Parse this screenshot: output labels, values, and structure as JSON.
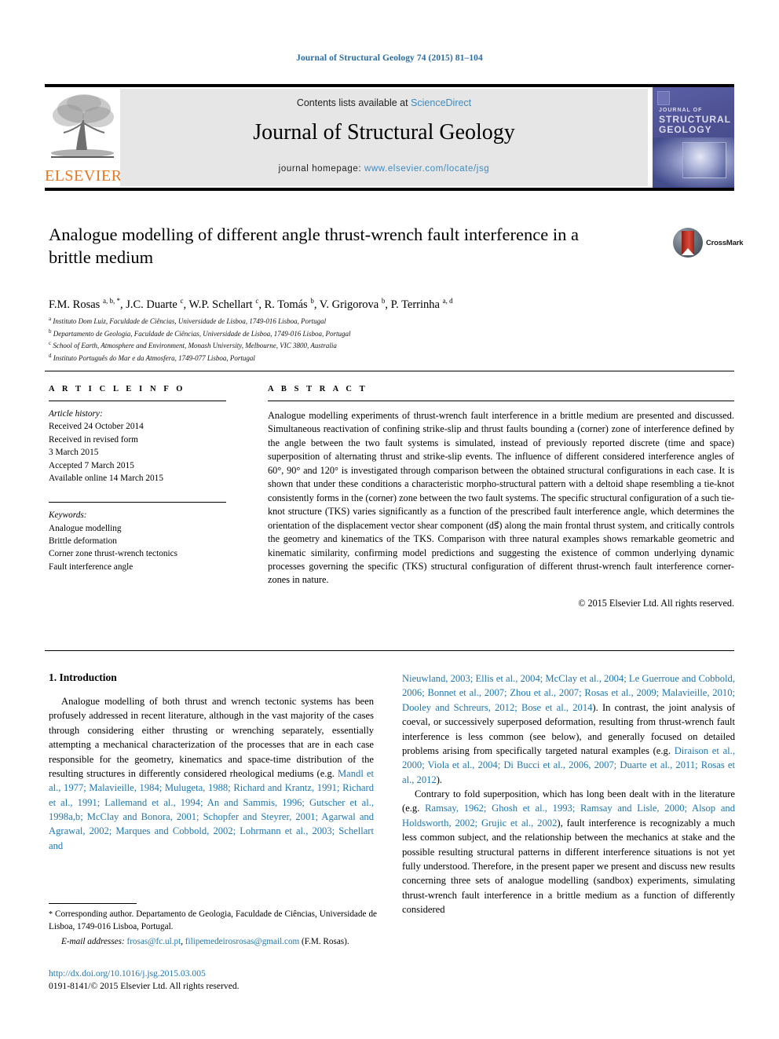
{
  "running_head": "Journal of Structural Geology 74 (2015) 81–104",
  "masthead": {
    "contents_prefix": "Contents lists available at ",
    "sciencedirect": "ScienceDirect",
    "journal_title": "Journal of Structural Geology",
    "homepage_prefix": "journal homepage: ",
    "homepage_url": "www.elsevier.com/locate/jsg",
    "publisher": "ELSEVIER",
    "cover": {
      "line1": "JOURNAL OF",
      "line2": "STRUCTURAL",
      "line3": "GEOLOGY"
    }
  },
  "article": {
    "title": "Analogue modelling of different angle thrust-wrench fault interference in a brittle medium",
    "crossmark_label": "CrossMark",
    "authors_html": "F.M. Rosas <sup>a, b, *</sup>, J.C. Duarte <sup>c</sup>, W.P. Schellart <sup>c</sup>, R. Tomás <sup>b</sup>, V. Grigorova <sup>b</sup>, P. Terrinha <sup>a, d</sup>",
    "affiliations": [
      {
        "mark": "a",
        "text": "Instituto Dom Luiz, Faculdade de Ciências, Universidade de Lisboa, 1749-016 Lisboa, Portugal"
      },
      {
        "mark": "b",
        "text": "Departamento de Geologia, Faculdade de Ciências, Universidade de Lisboa, 1749-016 Lisboa, Portugal"
      },
      {
        "mark": "c",
        "text": "School of Earth, Atmosphere and Environment, Monash University, Melbourne, VIC 3800, Australia"
      },
      {
        "mark": "d",
        "text": "Instituto Português do Mar e da Atmosfera, 1749-077 Lisboa, Portugal"
      }
    ]
  },
  "article_info": {
    "heading": "A R T I C L E   I N F O",
    "history_label": "Article history:",
    "history": [
      "Received 24 October 2014",
      "Received in revised form",
      "3 March 2015",
      "Accepted 7 March 2015",
      "Available online 14 March 2015"
    ],
    "keywords_label": "Keywords:",
    "keywords": [
      "Analogue modelling",
      "Brittle deformation",
      "Corner zone thrust-wrench tectonics",
      "Fault interference angle"
    ]
  },
  "abstract": {
    "heading": "A B S T R A C T",
    "text": "Analogue modelling experiments of thrust-wrench fault interference in a brittle medium are presented and discussed. Simultaneous reactivation of confining strike-slip and thrust faults bounding a (corner) zone of interference defined by the angle between the two fault systems is simulated, instead of previously reported discrete (time and space) superposition of alternating thrust and strike-slip events. The influence of different considered interference angles of 60°, 90° and 120° is investigated through comparison between the obtained structural configurations in each case. It is shown that under these conditions a characteristic morpho-structural pattern with a deltoid shape resembling a tie-knot consistently forms in the (corner) zone between the two fault systems. The specific structural configuration of a such tie-knot structure (TKS) varies significantly as a function of the prescribed fault interference angle, which determines the orientation of the displacement vector shear component (ds⃗) along the main frontal thrust system, and critically controls the geometry and kinematics of the TKS. Comparison with three natural examples shows remarkable geometric and kinematic similarity, confirming model predictions and suggesting the existence of common underlying dynamic processes governing the specific (TKS) structural configuration of different thrust-wrench fault interference corner-zones in nature.",
    "copyright": "© 2015 Elsevier Ltd. All rights reserved."
  },
  "body": {
    "section_heading": "1. Introduction",
    "left_paragraph_plain": "Analogue modelling of both thrust and wrench tectonic systems has been profusely addressed in recent literature, although in the vast majority of the cases through considering either thrusting or wrenching separately, essentially attempting a mechanical characterization of the processes that are in each case responsible for the geometry, kinematics and space-time distribution of the resulting structures in differently considered rheological mediums (e.g. ",
    "left_citations": "Mandl et al., 1977; Malavieille, 1984; Mulugeta, 1988; Richard and Krantz, 1991; Richard et al., 1991; Lallemand et al., 1994; An and Sammis, 1996; Gutscher et al., 1998a,b; McClay and Bonora, 2001; Schopfer and Steyrer, 2001; Agarwal and Agrawal, 2002; Marques and Cobbold, 2002; Lohrmann et al., 2003; Schellart and",
    "right_citations_cont": "Nieuwland, 2003; Ellis et al., 2004; McClay et al., 2004; Le Guerroue and Cobbold, 2006; Bonnet et al., 2007; Zhou et al., 2007; Rosas et al., 2009; Malavieille, 2010; Dooley and Schreurs, 2012; Bose et al., 2014",
    "right_p1_tail": "). In contrast, the joint analysis of coeval, or successively superposed deformation, resulting from thrust-wrench fault interference is less common (see below), and generally focused on detailed problems arising from specifically targeted natural examples (e.g. ",
    "right_p1_cites2": "Diraison et al., 2000; Viola et al., 2004; Di Bucci et al., 2006, 2007; Duarte et al., 2011; Rosas et al., 2012",
    "right_p1_end": ").",
    "right_p2_a": "Contrary to fold superposition, which has long been dealt with in the literature (e.g. ",
    "right_p2_cites": "Ramsay, 1962; Ghosh et al., 1993; Ramsay and Lisle, 2000; Alsop and Holdsworth, 2002; Grujic et al., 2002",
    "right_p2_b": "), fault interference is recognizably a much less common subject, and the relationship between the mechanics at stake and the possible resulting structural patterns in different interference situations is not yet fully understood. Therefore, in the present paper we present and discuss new results concerning three sets of analogue modelling (sandbox) experiments, simulating thrust-wrench fault interference in a brittle medium as a function of differently considered"
  },
  "footnote": {
    "star": "*",
    "corresponding": " Corresponding author. Departamento de Geologia, Faculdade de Ciências, Universidade de Lisboa, 1749-016 Lisboa, Portugal.",
    "email_label": "E-mail addresses:",
    "email1": "frosas@fc.ul.pt",
    "email_sep": ", ",
    "email2": "filipemedeirosrosas@gmail.com",
    "email_tail": " (F.M. Rosas)."
  },
  "footer": {
    "doi": "http://dx.doi.org/10.1016/j.jsg.2015.03.005",
    "issn_line": "0191-8141/© 2015 Elsevier Ltd. All rights reserved."
  },
  "colors": {
    "link": "#1f76b4",
    "header_blue": "#2b6ca3",
    "elsevier_orange": "#E87722",
    "band_grey": "#e6e6e6"
  }
}
